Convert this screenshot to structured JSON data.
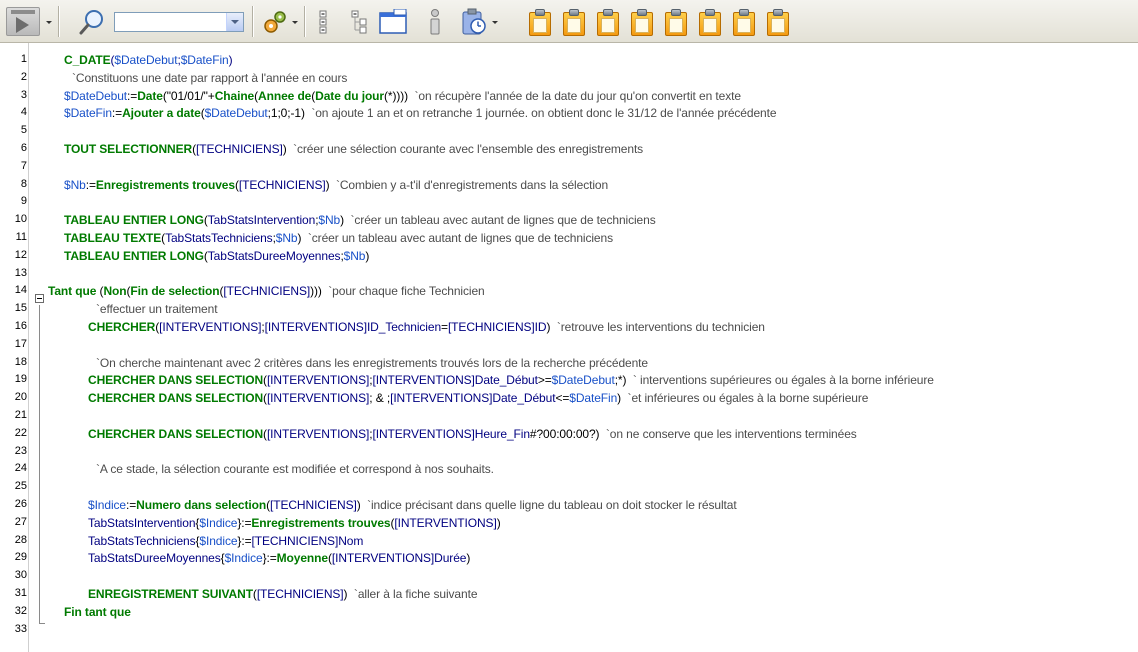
{
  "toolbar": {
    "run_icon": "run-method-icon",
    "search_icon": "magnifier-icon",
    "search_value": "",
    "options_icon": "gear-icon",
    "clipboard_count": 8
  },
  "editor": {
    "line_numbers": [
      "1",
      "2",
      "3",
      "4",
      "5",
      "6",
      "7",
      "8",
      "9",
      "10",
      "11",
      "12",
      "13",
      "14",
      "15",
      "16",
      "17",
      "18",
      "19",
      "20",
      "21",
      "22",
      "23",
      "24",
      "25",
      "26",
      "27",
      "28",
      "29",
      "30",
      "31",
      "32",
      "33"
    ],
    "lines": [
      {
        "n": 1,
        "indent": 64,
        "segments": [
          [
            "k",
            "C_DATE"
          ],
          [
            "t",
            "("
          ],
          [
            "v",
            "$DateDebut"
          ],
          [
            "t",
            ";"
          ],
          [
            "v",
            "$DateFin"
          ],
          [
            "t",
            ")"
          ]
        ]
      },
      {
        "n": 2,
        "indent": 72,
        "segments": [
          [
            "c",
            "`Constituons une date par rapport à l'année en cours"
          ]
        ]
      },
      {
        "n": 3,
        "indent": 64,
        "segments": [
          [
            "v",
            "$DateDebut"
          ],
          [
            "s",
            ":="
          ],
          [
            "k",
            "Date"
          ],
          [
            "s",
            "(\"01/01/\"+"
          ],
          [
            "k",
            "Chaine"
          ],
          [
            "s",
            "("
          ],
          [
            "k",
            "Annee de"
          ],
          [
            "s",
            "("
          ],
          [
            "k",
            "Date du jour"
          ],
          [
            "s",
            "(*))))  "
          ],
          [
            "c",
            "`on récupère l'année de la date du jour qu'on convertit en texte"
          ]
        ]
      },
      {
        "n": 4,
        "indent": 64,
        "segments": [
          [
            "v",
            "$DateFin"
          ],
          [
            "s",
            ":="
          ],
          [
            "k",
            "Ajouter a date"
          ],
          [
            "s",
            "("
          ],
          [
            "v",
            "$DateDebut"
          ],
          [
            "s",
            ";1;0;-1)  "
          ],
          [
            "c",
            "`on ajoute 1 an et on retranche 1 journée. on obtient donc le 31/12 de l'année précédente"
          ]
        ]
      },
      {
        "n": 5,
        "indent": 64,
        "segments": []
      },
      {
        "n": 6,
        "indent": 64,
        "segments": [
          [
            "k",
            "TOUT SELECTIONNER"
          ],
          [
            "s",
            "("
          ],
          [
            "t",
            "[TECHNICIENS]"
          ],
          [
            "s",
            ")  "
          ],
          [
            "c",
            "`créer une sélection courante avec l'ensemble des enregistrements"
          ]
        ]
      },
      {
        "n": 7,
        "indent": 64,
        "segments": []
      },
      {
        "n": 8,
        "indent": 64,
        "segments": [
          [
            "v",
            "$Nb"
          ],
          [
            "s",
            ":="
          ],
          [
            "k",
            "Enregistrements trouves"
          ],
          [
            "s",
            "("
          ],
          [
            "t",
            "[TECHNICIENS]"
          ],
          [
            "s",
            ")  "
          ],
          [
            "c",
            "`Combien y a-t'il d'enregistrements dans la sélection"
          ]
        ]
      },
      {
        "n": 9,
        "indent": 64,
        "segments": []
      },
      {
        "n": 10,
        "indent": 64,
        "segments": [
          [
            "k",
            "TABLEAU ENTIER LONG"
          ],
          [
            "s",
            "("
          ],
          [
            "t",
            "TabStatsIntervention"
          ],
          [
            "s",
            ";"
          ],
          [
            "v",
            "$Nb"
          ],
          [
            "s",
            ")  "
          ],
          [
            "c",
            "`créer un tableau avec autant de lignes que de techniciens"
          ]
        ]
      },
      {
        "n": 11,
        "indent": 64,
        "segments": [
          [
            "k",
            "TABLEAU TEXTE"
          ],
          [
            "s",
            "("
          ],
          [
            "t",
            "TabStatsTechniciens"
          ],
          [
            "s",
            ";"
          ],
          [
            "v",
            "$Nb"
          ],
          [
            "s",
            ")  "
          ],
          [
            "c",
            "`créer un tableau avec autant de lignes que de techniciens"
          ]
        ]
      },
      {
        "n": 12,
        "indent": 64,
        "segments": [
          [
            "k",
            "TABLEAU ENTIER LONG"
          ],
          [
            "s",
            "("
          ],
          [
            "t",
            "TabStatsDureeMoyennes"
          ],
          [
            "s",
            ";"
          ],
          [
            "v",
            "$Nb"
          ],
          [
            "s",
            ")"
          ]
        ]
      },
      {
        "n": 13,
        "indent": 64,
        "segments": []
      },
      {
        "n": 14,
        "indent": 48,
        "segments": [
          [
            "k",
            "Tant que"
          ],
          [
            "s",
            " ("
          ],
          [
            "k",
            "Non"
          ],
          [
            "s",
            "("
          ],
          [
            "k",
            "Fin de selection"
          ],
          [
            "s",
            "("
          ],
          [
            "t",
            "[TECHNICIENS]"
          ],
          [
            "s",
            ")))  "
          ],
          [
            "c",
            "`pour chaque fiche Technicien"
          ]
        ]
      },
      {
        "n": 15,
        "indent": 96,
        "segments": [
          [
            "c",
            "`effectuer un traitement"
          ]
        ]
      },
      {
        "n": 16,
        "indent": 88,
        "segments": [
          [
            "k",
            "CHERCHER"
          ],
          [
            "s",
            "("
          ],
          [
            "t",
            "[INTERVENTIONS]"
          ],
          [
            "s",
            ";"
          ],
          [
            "t",
            "[INTERVENTIONS]ID_Technicien"
          ],
          [
            "s",
            "="
          ],
          [
            "t",
            "[TECHNICIENS]ID"
          ],
          [
            "s",
            ")  "
          ],
          [
            "c",
            "`retrouve les interventions du technicien"
          ]
        ]
      },
      {
        "n": 17,
        "indent": 88,
        "segments": []
      },
      {
        "n": 18,
        "indent": 96,
        "segments": [
          [
            "c",
            "`On cherche maintenant avec 2 critères dans les enregistrements trouvés lors de la recherche précédente"
          ]
        ]
      },
      {
        "n": 19,
        "indent": 88,
        "segments": [
          [
            "k",
            "CHERCHER DANS SELECTION"
          ],
          [
            "s",
            "("
          ],
          [
            "t",
            "[INTERVENTIONS]"
          ],
          [
            "s",
            ";"
          ],
          [
            "t",
            "[INTERVENTIONS]Date_Début"
          ],
          [
            "s",
            ">="
          ],
          [
            "v",
            "$DateDebut"
          ],
          [
            "s",
            ";*)  "
          ],
          [
            "c",
            "` interventions supérieures ou égales à la borne inférieure"
          ]
        ]
      },
      {
        "n": 20,
        "indent": 88,
        "segments": [
          [
            "k",
            "CHERCHER DANS SELECTION"
          ],
          [
            "s",
            "("
          ],
          [
            "t",
            "[INTERVENTIONS]"
          ],
          [
            "s",
            "; & ;"
          ],
          [
            "t",
            "[INTERVENTIONS]Date_Début"
          ],
          [
            "s",
            "<="
          ],
          [
            "v",
            "$DateFin"
          ],
          [
            "s",
            ")  "
          ],
          [
            "c",
            "`et inférieures ou égales à la borne supérieure"
          ]
        ]
      },
      {
        "n": 21,
        "indent": 88,
        "segments": []
      },
      {
        "n": 22,
        "indent": 88,
        "segments": [
          [
            "k",
            "CHERCHER DANS SELECTION"
          ],
          [
            "s",
            "("
          ],
          [
            "t",
            "[INTERVENTIONS]"
          ],
          [
            "s",
            ";"
          ],
          [
            "t",
            "[INTERVENTIONS]Heure_Fin"
          ],
          [
            "s",
            "#?00:00:00?)  "
          ],
          [
            "c",
            "`on ne conserve que les interventions terminées"
          ]
        ]
      },
      {
        "n": 23,
        "indent": 88,
        "segments": []
      },
      {
        "n": 24,
        "indent": 96,
        "segments": [
          [
            "c",
            "`A ce stade, la sélection courante est modifiée et correspond à nos souhaits."
          ]
        ]
      },
      {
        "n": 25,
        "indent": 88,
        "segments": []
      },
      {
        "n": 26,
        "indent": 88,
        "segments": [
          [
            "v",
            "$Indice"
          ],
          [
            "s",
            ":="
          ],
          [
            "k",
            "Numero dans selection"
          ],
          [
            "s",
            "("
          ],
          [
            "t",
            "[TECHNICIENS]"
          ],
          [
            "s",
            ")  "
          ],
          [
            "c",
            "`indice précisant dans quelle ligne du tableau on doit stocker le résultat"
          ]
        ]
      },
      {
        "n": 27,
        "indent": 88,
        "segments": [
          [
            "t",
            "TabStatsIntervention"
          ],
          [
            "s",
            "{"
          ],
          [
            "v",
            "$Indice"
          ],
          [
            "s",
            "}:="
          ],
          [
            "k",
            "Enregistrements trouves"
          ],
          [
            "s",
            "("
          ],
          [
            "t",
            "[INTERVENTIONS]"
          ],
          [
            "s",
            ")"
          ]
        ]
      },
      {
        "n": 28,
        "indent": 88,
        "segments": [
          [
            "t",
            "TabStatsTechniciens"
          ],
          [
            "s",
            "{"
          ],
          [
            "v",
            "$Indice"
          ],
          [
            "s",
            "}:="
          ],
          [
            "t",
            "[TECHNICIENS]Nom"
          ]
        ]
      },
      {
        "n": 29,
        "indent": 88,
        "segments": [
          [
            "t",
            "TabStatsDureeMoyennes"
          ],
          [
            "s",
            "{"
          ],
          [
            "v",
            "$Indice"
          ],
          [
            "s",
            "}:="
          ],
          [
            "k",
            "Moyenne"
          ],
          [
            "s",
            "("
          ],
          [
            "t",
            "[INTERVENTIONS]Durée"
          ],
          [
            "s",
            ")"
          ]
        ]
      },
      {
        "n": 30,
        "indent": 88,
        "segments": []
      },
      {
        "n": 31,
        "indent": 88,
        "segments": [
          [
            "k",
            "ENREGISTREMENT SUIVANT"
          ],
          [
            "s",
            "("
          ],
          [
            "t",
            "[TECHNICIENS]"
          ],
          [
            "s",
            ")  "
          ],
          [
            "c",
            "`aller à la fiche suivante"
          ]
        ]
      },
      {
        "n": 32,
        "indent": 64,
        "segments": [
          [
            "k",
            "Fin tant que"
          ]
        ]
      },
      {
        "n": 33,
        "indent": 64,
        "segments": []
      }
    ]
  }
}
